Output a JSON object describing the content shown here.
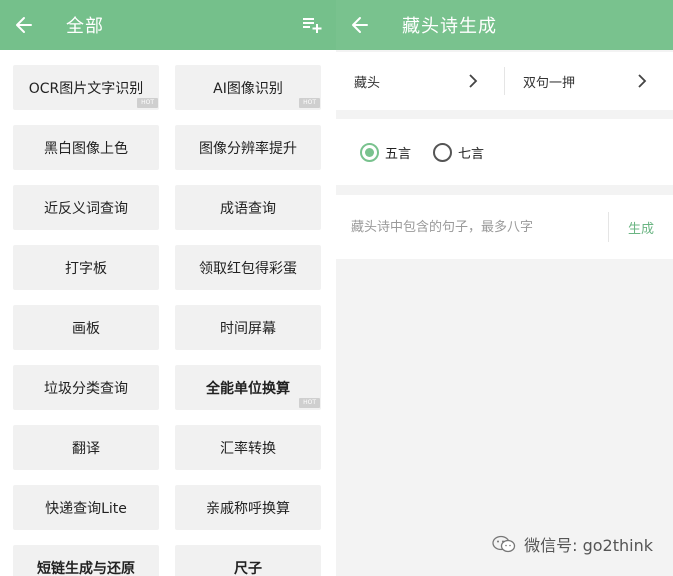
{
  "left": {
    "title": "全部",
    "tiles": [
      {
        "label": "OCR图片文字识别",
        "hot": true,
        "bold": false
      },
      {
        "label": "AI图像识别",
        "hot": true,
        "bold": false
      },
      {
        "label": "黑白图像上色",
        "hot": false,
        "bold": false
      },
      {
        "label": "图像分辨率提升",
        "hot": false,
        "bold": false
      },
      {
        "label": "近反义词查询",
        "hot": false,
        "bold": false
      },
      {
        "label": "成语查询",
        "hot": false,
        "bold": false
      },
      {
        "label": "打字板",
        "hot": false,
        "bold": false
      },
      {
        "label": "领取红包得彩蛋",
        "hot": false,
        "bold": false
      },
      {
        "label": "画板",
        "hot": false,
        "bold": false
      },
      {
        "label": "时间屏幕",
        "hot": false,
        "bold": false
      },
      {
        "label": "垃圾分类查询",
        "hot": false,
        "bold": false
      },
      {
        "label": "全能单位换算",
        "hot": true,
        "bold": true
      },
      {
        "label": "翻译",
        "hot": false,
        "bold": false
      },
      {
        "label": "汇率转换",
        "hot": false,
        "bold": false
      },
      {
        "label": "快递查询Lite",
        "hot": false,
        "bold": false
      },
      {
        "label": "亲戚称呼换算",
        "hot": false,
        "bold": false
      },
      {
        "label": "短链生成与还原",
        "hot": false,
        "bold": true
      },
      {
        "label": "尺子",
        "hot": false,
        "bold": true
      }
    ],
    "hot_badge": "HOT"
  },
  "right": {
    "title": "藏头诗生成",
    "selectors": [
      {
        "label": "藏头"
      },
      {
        "label": "双句一押"
      }
    ],
    "radios": [
      {
        "label": "五言",
        "checked": true
      },
      {
        "label": "七言",
        "checked": false
      }
    ],
    "input": {
      "value": "",
      "placeholder": "藏头诗中包含的句子，最多八字"
    },
    "generate_label": "生成"
  },
  "watermark": {
    "text": "微信号: go2think"
  },
  "colors": {
    "appbar_green": "#79c28e",
    "accent_green": "#6bb583"
  }
}
